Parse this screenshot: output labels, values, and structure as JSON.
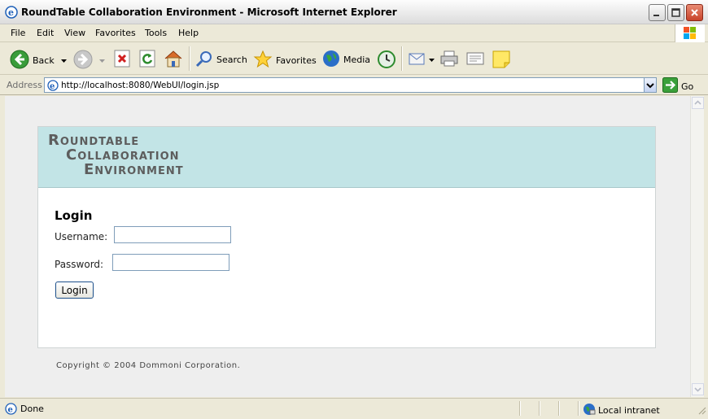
{
  "window": {
    "title": "RoundTable Collaboration Environment - Microsoft Internet Explorer"
  },
  "menu": {
    "items": [
      "File",
      "Edit",
      "View",
      "Favorites",
      "Tools",
      "Help"
    ]
  },
  "toolbar": {
    "back_label": "Back",
    "search_label": "Search",
    "favorites_label": "Favorites",
    "media_label": "Media"
  },
  "address": {
    "label": "Address",
    "url": "http://localhost:8080/WebUI/login.jsp",
    "go_label": "Go"
  },
  "page": {
    "logo_lines": [
      "Roundtable",
      "Collaboration",
      "Environment"
    ],
    "heading": "Login",
    "username_label": "Username:",
    "password_label": "Password:",
    "username_value": "",
    "password_value": "",
    "login_button": "Login",
    "copyright": "Copyright © 2004 Dommoni Corporation."
  },
  "status": {
    "text": "Done",
    "zone": "Local intranet"
  },
  "colors": {
    "banner": "#c2e4e6",
    "logo_text": "#5d5d5d",
    "page_bg": "#eeeeee"
  }
}
